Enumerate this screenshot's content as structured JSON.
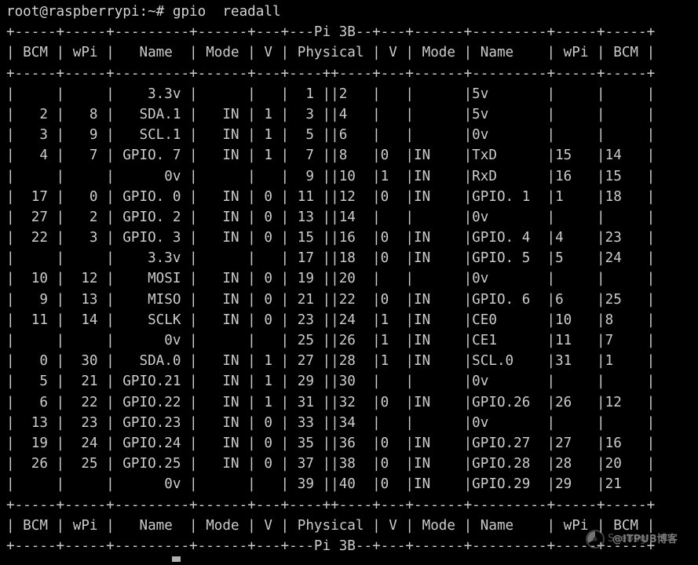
{
  "terminal": {
    "prompt": "root@raspberrypi:~# gpio  readall",
    "user_host": "root@raspberrypi",
    "cwd": "~",
    "prompt_symbol": "#",
    "command": "gpio  readall",
    "foreground_color": "#cccccc",
    "background_color": "#000000",
    "cursor_visible": true
  },
  "table": {
    "board_title": "Pi 3B",
    "top_border": "+-----+-----+---------+------+---+---Pi 3B--+---+------+---------+-----+-----+",
    "header_border": "+-----+-----+---------+------+---+----++----+---+------+---------+-----+-----+",
    "bottom_border": "+-----+-----+---------+------+---+----++----+---+------+---------+-----+-----+",
    "footer_border": "+-----+-----+---------+------+---+---Pi 3B--+---+------+---------+-----+-----+",
    "header_line": "| BCM | wPi |   Name  | Mode | V | Physical | V | Mode | Name    | wPi | BCM |",
    "columns": [
      "BCM",
      "wPi",
      "Name",
      "Mode",
      "V",
      "Physical",
      "V",
      "Mode",
      "Name",
      "wPi",
      "BCM"
    ],
    "rows": [
      {
        "bcm_l": "",
        "wpi_l": "",
        "name_l": "3.3v",
        "mode_l": "",
        "v_l": "",
        "phys_l": "1",
        "phys_r": "2",
        "v_r": "",
        "mode_r": "",
        "name_r": "5v",
        "wpi_r": "",
        "bcm_r": ""
      },
      {
        "bcm_l": "2",
        "wpi_l": "8",
        "name_l": "SDA.1",
        "mode_l": "IN",
        "v_l": "1",
        "phys_l": "3",
        "phys_r": "4",
        "v_r": "",
        "mode_r": "",
        "name_r": "5v",
        "wpi_r": "",
        "bcm_r": ""
      },
      {
        "bcm_l": "3",
        "wpi_l": "9",
        "name_l": "SCL.1",
        "mode_l": "IN",
        "v_l": "1",
        "phys_l": "5",
        "phys_r": "6",
        "v_r": "",
        "mode_r": "",
        "name_r": "0v",
        "wpi_r": "",
        "bcm_r": ""
      },
      {
        "bcm_l": "4",
        "wpi_l": "7",
        "name_l": "GPIO. 7",
        "mode_l": "IN",
        "v_l": "1",
        "phys_l": "7",
        "phys_r": "8",
        "v_r": "0",
        "mode_r": "IN",
        "name_r": "TxD",
        "wpi_r": "15",
        "bcm_r": "14"
      },
      {
        "bcm_l": "",
        "wpi_l": "",
        "name_l": "0v",
        "mode_l": "",
        "v_l": "",
        "phys_l": "9",
        "phys_r": "10",
        "v_r": "1",
        "mode_r": "IN",
        "name_r": "RxD",
        "wpi_r": "16",
        "bcm_r": "15"
      },
      {
        "bcm_l": "17",
        "wpi_l": "0",
        "name_l": "GPIO. 0",
        "mode_l": "IN",
        "v_l": "0",
        "phys_l": "11",
        "phys_r": "12",
        "v_r": "0",
        "mode_r": "IN",
        "name_r": "GPIO. 1",
        "wpi_r": "1",
        "bcm_r": "18"
      },
      {
        "bcm_l": "27",
        "wpi_l": "2",
        "name_l": "GPIO. 2",
        "mode_l": "IN",
        "v_l": "0",
        "phys_l": "13",
        "phys_r": "14",
        "v_r": "",
        "mode_r": "",
        "name_r": "0v",
        "wpi_r": "",
        "bcm_r": ""
      },
      {
        "bcm_l": "22",
        "wpi_l": "3",
        "name_l": "GPIO. 3",
        "mode_l": "IN",
        "v_l": "0",
        "phys_l": "15",
        "phys_r": "16",
        "v_r": "0",
        "mode_r": "IN",
        "name_r": "GPIO. 4",
        "wpi_r": "4",
        "bcm_r": "23"
      },
      {
        "bcm_l": "",
        "wpi_l": "",
        "name_l": "3.3v",
        "mode_l": "",
        "v_l": "",
        "phys_l": "17",
        "phys_r": "18",
        "v_r": "0",
        "mode_r": "IN",
        "name_r": "GPIO. 5",
        "wpi_r": "5",
        "bcm_r": "24"
      },
      {
        "bcm_l": "10",
        "wpi_l": "12",
        "name_l": "MOSI",
        "mode_l": "IN",
        "v_l": "0",
        "phys_l": "19",
        "phys_r": "20",
        "v_r": "",
        "mode_r": "",
        "name_r": "0v",
        "wpi_r": "",
        "bcm_r": ""
      },
      {
        "bcm_l": "9",
        "wpi_l": "13",
        "name_l": "MISO",
        "mode_l": "IN",
        "v_l": "0",
        "phys_l": "21",
        "phys_r": "22",
        "v_r": "0",
        "mode_r": "IN",
        "name_r": "GPIO. 6",
        "wpi_r": "6",
        "bcm_r": "25"
      },
      {
        "bcm_l": "11",
        "wpi_l": "14",
        "name_l": "SCLK",
        "mode_l": "IN",
        "v_l": "0",
        "phys_l": "23",
        "phys_r": "24",
        "v_r": "1",
        "mode_r": "IN",
        "name_r": "CE0",
        "wpi_r": "10",
        "bcm_r": "8"
      },
      {
        "bcm_l": "",
        "wpi_l": "",
        "name_l": "0v",
        "mode_l": "",
        "v_l": "",
        "phys_l": "25",
        "phys_r": "26",
        "v_r": "1",
        "mode_r": "IN",
        "name_r": "CE1",
        "wpi_r": "11",
        "bcm_r": "7"
      },
      {
        "bcm_l": "0",
        "wpi_l": "30",
        "name_l": "SDA.0",
        "mode_l": "IN",
        "v_l": "1",
        "phys_l": "27",
        "phys_r": "28",
        "v_r": "1",
        "mode_r": "IN",
        "name_r": "SCL.0",
        "wpi_r": "31",
        "bcm_r": "1"
      },
      {
        "bcm_l": "5",
        "wpi_l": "21",
        "name_l": "GPIO.21",
        "mode_l": "IN",
        "v_l": "1",
        "phys_l": "29",
        "phys_r": "30",
        "v_r": "",
        "mode_r": "",
        "name_r": "0v",
        "wpi_r": "",
        "bcm_r": ""
      },
      {
        "bcm_l": "6",
        "wpi_l": "22",
        "name_l": "GPIO.22",
        "mode_l": "IN",
        "v_l": "1",
        "phys_l": "31",
        "phys_r": "32",
        "v_r": "0",
        "mode_r": "IN",
        "name_r": "GPIO.26",
        "wpi_r": "26",
        "bcm_r": "12"
      },
      {
        "bcm_l": "13",
        "wpi_l": "23",
        "name_l": "GPIO.23",
        "mode_l": "IN",
        "v_l": "0",
        "phys_l": "33",
        "phys_r": "34",
        "v_r": "",
        "mode_r": "",
        "name_r": "0v",
        "wpi_r": "",
        "bcm_r": ""
      },
      {
        "bcm_l": "19",
        "wpi_l": "24",
        "name_l": "GPIO.24",
        "mode_l": "IN",
        "v_l": "0",
        "phys_l": "35",
        "phys_r": "36",
        "v_r": "0",
        "mode_r": "IN",
        "name_r": "GPIO.27",
        "wpi_r": "27",
        "bcm_r": "16"
      },
      {
        "bcm_l": "26",
        "wpi_l": "25",
        "name_l": "GPIO.25",
        "mode_l": "IN",
        "v_l": "0",
        "phys_l": "37",
        "phys_r": "38",
        "v_r": "0",
        "mode_r": "IN",
        "name_r": "GPIO.28",
        "wpi_r": "28",
        "bcm_r": "20"
      },
      {
        "bcm_l": "",
        "wpi_l": "",
        "name_l": "0v",
        "mode_l": "",
        "v_l": "",
        "phys_l": "39",
        "phys_r": "40",
        "v_r": "0",
        "mode_r": "IN",
        "name_r": "GPIO.29",
        "wpi_r": "29",
        "bcm_r": "21"
      }
    ]
  },
  "watermark": {
    "brand": "Seebug",
    "site": "@ITPUB博客"
  }
}
